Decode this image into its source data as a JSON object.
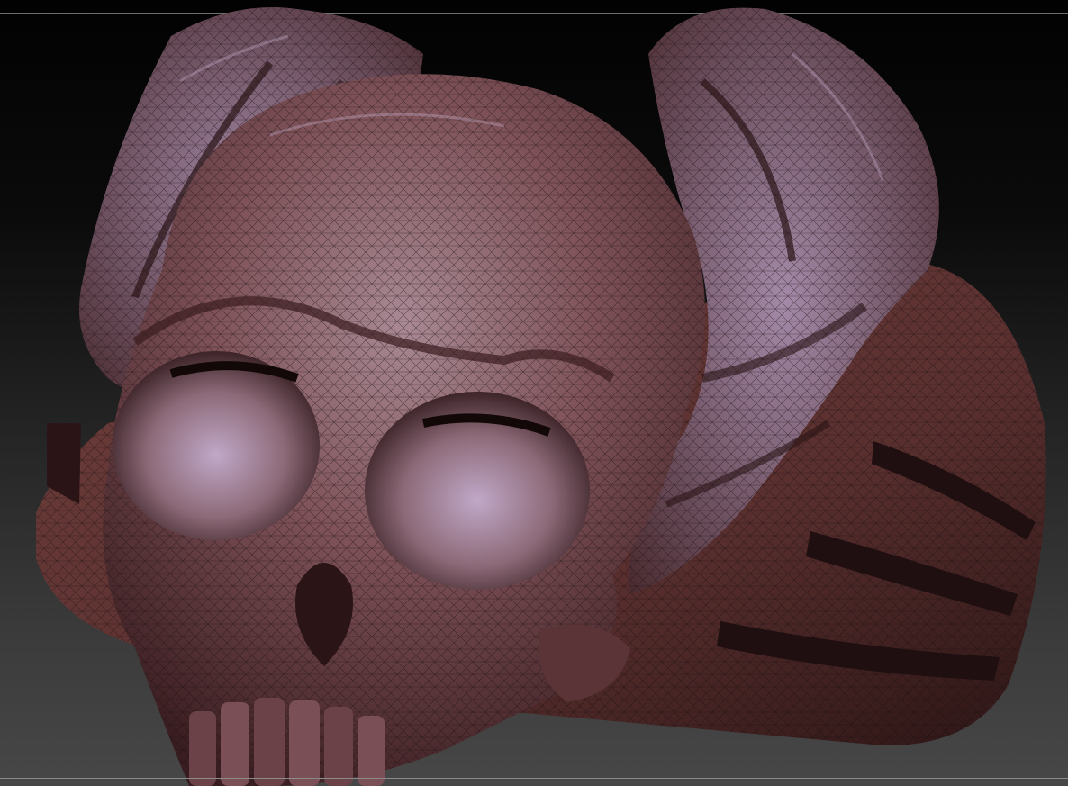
{
  "viewport": {
    "background_top": "#020202",
    "background_bottom": "#474747",
    "frame_line_color": "#6e6e6e"
  },
  "model": {
    "material_color": "#8a5a5c",
    "shadow_color": "#2a1416",
    "highlight_color": "#b49ab6",
    "wire_color": "#1a0e10",
    "subject_icon": "skull-ring-icon"
  }
}
